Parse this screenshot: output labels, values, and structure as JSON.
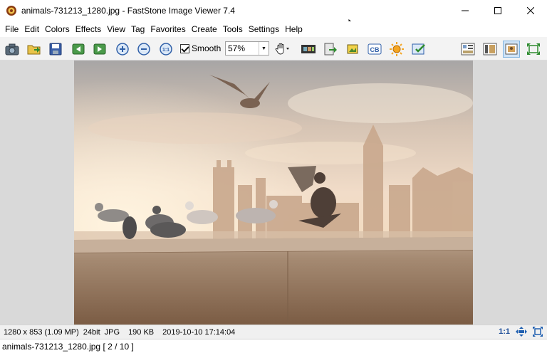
{
  "window": {
    "title": "animals-731213_1280.jpg  -  FastStone Image Viewer 7.4",
    "controls": [
      "minimize-icon",
      "maximize-icon",
      "close-icon"
    ]
  },
  "menu": {
    "items": [
      "File",
      "Edit",
      "Colors",
      "Effects",
      "View",
      "Tag",
      "Favorites",
      "Create",
      "Tools",
      "Settings",
      "Help"
    ]
  },
  "toolbar": {
    "smooth_label": "Smooth",
    "smooth_checked": true,
    "zoom_value": "57%",
    "icons": [
      "camera-icon",
      "open-folder-icon",
      "save-icon",
      "previous-icon",
      "next-icon",
      "zoom-in-icon",
      "zoom-out-icon",
      "actual-size-icon",
      "hand-tool-icon",
      "slideshow-icon",
      "export-icon",
      "crop-icon",
      "convert-icon",
      "adjust-lighting-icon",
      "batch-icon",
      "browser-layout-icon",
      "thumbnail-layout-icon",
      "image-view-icon",
      "fullscreen-icon"
    ]
  },
  "status": {
    "dimensions": "1280 x 853 (1.09 MP)",
    "bit_depth": "24bit",
    "format": "JPG",
    "size": "190 KB",
    "datetime": "2019-10-10 17:14:04",
    "zoom_actual": "1:1"
  },
  "file_bar": {
    "text": "animals-731213_1280.jpg [ 2 / 10 ]"
  }
}
